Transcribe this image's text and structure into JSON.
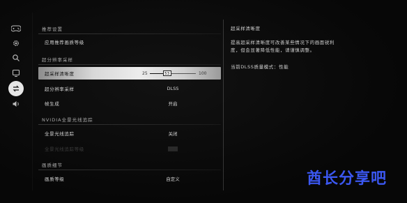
{
  "rail": {
    "icons": [
      {
        "name": "gamepad-icon",
        "glyph": "🎮"
      },
      {
        "name": "gear-icon",
        "glyph": "⚙"
      },
      {
        "name": "search-icon",
        "glyph": "⌕"
      },
      {
        "name": "monitor-icon",
        "glyph": "▭"
      },
      {
        "name": "swap-arrows-icon",
        "glyph": "⇄"
      },
      {
        "name": "speaker-icon",
        "glyph": "🔈"
      }
    ],
    "active_index": 4
  },
  "sections": {
    "recommended": {
      "title": "推荐设置",
      "apply_label": "应用推荐画质等级"
    },
    "supersampling": {
      "title": "超分辨率采样",
      "sharpness_label": "超采样清晰度",
      "sharpness_min": "25",
      "sharpness_value": "53",
      "sharpness_max": "100",
      "sharpness_fraction": 0.373,
      "mode_label": "超分辨率采样",
      "mode_value": "DLSS",
      "framegen_label": "帧生成",
      "framegen_value": "开启"
    },
    "raytracing": {
      "title": "NVIDIA全景光线追踪",
      "fullrt_label": "全景光线追踪",
      "fullrt_value": "关闭",
      "fullrt_quality_label": "全景光线追踪等级"
    },
    "quality": {
      "title": "画质细节",
      "level_label": "画质等级",
      "level_value": "自定义"
    }
  },
  "description": {
    "title": "超采样清晰度",
    "body_line1": "提高超采样清晰度可改善某些情况下的画面锐利",
    "body_line2": "度，但会显著降低性能，请谨慎调整。",
    "current_mode": "当前DLSS质量模式：性能"
  },
  "watermark": "酋长分享吧"
}
